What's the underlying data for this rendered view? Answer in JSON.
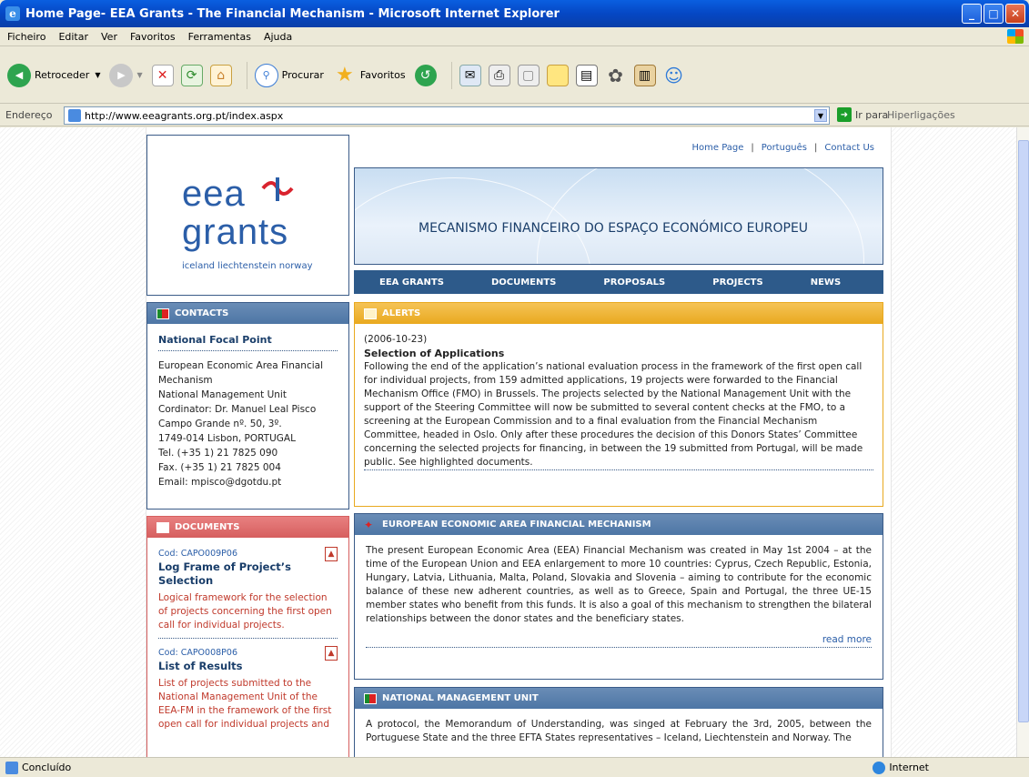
{
  "window": {
    "title": "Home Page- EEA Grants - The Financial Mechanism - Microsoft Internet Explorer"
  },
  "menu": [
    "Ficheiro",
    "Editar",
    "Ver",
    "Favoritos",
    "Ferramentas",
    "Ajuda"
  ],
  "toolbar": {
    "back": "Retroceder",
    "search": "Procurar",
    "favorites": "Favoritos"
  },
  "address": {
    "label": "Endereço",
    "url": "http://www.eeagrants.org.pt/index.aspx",
    "go": "Ir para",
    "links": "Hiperligações"
  },
  "status": {
    "text": "Concluído",
    "zone": "Internet"
  },
  "logo": {
    "line1": "eea",
    "line2": "grants",
    "tagline": "iceland liechtenstein norway"
  },
  "toplinks": [
    "Home Page",
    "Português",
    "Contact Us"
  ],
  "banner": {
    "title": "MECANISMO FINANCEIRO DO ESPAÇO ECONÓMICO EUROPEU"
  },
  "nav": [
    "EEA GRANTS",
    "DOCUMENTS",
    "PROPOSALS",
    "PROJECTS",
    "NEWS"
  ],
  "contacts": {
    "header": "CONTACTS",
    "title": "National Focal Point",
    "lines": [
      "European Economic Area Financial Mechanism",
      "National Management Unit",
      "Cordinator: Dr. Manuel Leal Pisco",
      "Campo Grande nº. 50, 3º.",
      "1749-014 Lisbon, PORTUGAL",
      "Tel. (+35 1) 21 7825 090",
      "Fax. (+35 1) 21 7825 004",
      "Email: mpisco@dgotdu.pt"
    ]
  },
  "alerts": {
    "header": "ALERTS",
    "date": "(2006-10-23)",
    "title": "Selection of Applications",
    "text": "Following the end of the application’s national evaluation process in the framework of the first open call for individual projects, from 159 admitted applications, 19 projects were forwarded to the Financial Mechanism Office (FMO) in Brussels. The projects selected by the National Management Unit with the support of the Steering Committee will now be submitted to several content checks at the FMO, to a screening at the European Commission and to a final evaluation from the Financial Mechanism Committee, headed in Oslo. Only after these procedures the decision of this Donors States’ Committee concerning the selected projects for financing, in between the 19 submitted from Portugal, will be made public. See highlighted documents."
  },
  "eea": {
    "header": "EUROPEAN ECONOMIC AREA FINANCIAL MECHANISM",
    "text": "The present European Economic Area (EEA) Financial Mechanism was created in May 1st 2004 – at the time of the European Union and EEA enlargement to more 10 countries: Cyprus, Czech Republic, Estonia, Hungary, Latvia, Lithuania, Malta, Poland, Slovakia and Slovenia – aiming to contribute for the economic balance of these new adherent countries, as well as to Greece, Spain and Portugal, the three UE-15 member states who benefit from this funds. It is also a goal of this mechanism to strengthen the bilateral relationships between the donor states and the beneficiary states.",
    "readmore": "read more"
  },
  "documents": {
    "header": "DOCUMENTS",
    "items": [
      {
        "cod": "Cod: CAPO009P06",
        "title": "Log Frame of Project’s Selection",
        "text": "Logical framework for the selection of projects concerning the first open call for individual projects."
      },
      {
        "cod": "Cod: CAPO008P06",
        "title": "List of Results",
        "text": "List of projects submitted to the National Management Unit of the EEA-FM in the framework of the first open call for individual projects and"
      }
    ]
  },
  "nmu": {
    "header": "NATIONAL MANAGEMENT UNIT",
    "text": "A protocol, the Memorandum of Understanding, was singed at February the 3rd, 2005, between the Portuguese State and the three EFTA States representatives – Iceland, Liechtenstein and Norway. The"
  }
}
